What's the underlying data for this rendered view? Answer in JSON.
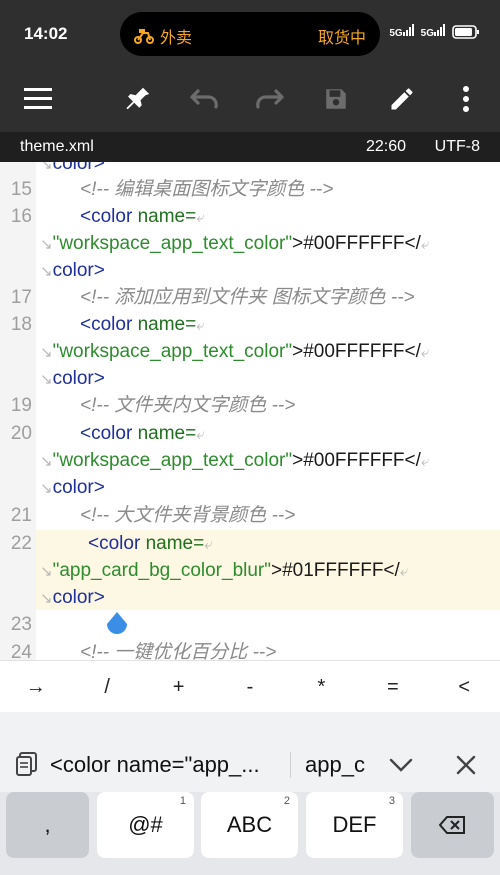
{
  "status_bar": {
    "time": "14:02",
    "island_app": "外卖",
    "island_status": "取货中",
    "signal1": "5G",
    "signal2": "5G"
  },
  "toolbar": {
    "icons": [
      "menu-icon",
      "pin-icon",
      "undo-icon",
      "redo-icon",
      "save-icon",
      "edit-icon",
      "more-icon"
    ]
  },
  "file_info": {
    "filename": "theme.xml",
    "position": "22:60",
    "encoding": "UTF-8"
  },
  "editor": {
    "top_partial": "color>",
    "lines": [
      {
        "num": "15",
        "comment": "<!-- 编辑桌面图标文字颜色 -->"
      },
      {
        "num": "16",
        "open": "<color",
        "attr": "name=",
        "value": "\"workspace_app_text_color\"",
        "text": ">#00FFFFFF</",
        "close": "color>"
      },
      {
        "num": "17",
        "comment": "<!-- 添加应用到文件夹 图标文字颜色 -->"
      },
      {
        "num": "18",
        "open": "<color",
        "attr": "name=",
        "value": "\"workspace_app_text_color\"",
        "text": ">#00FFFFFF</",
        "close": "color>"
      },
      {
        "num": "19",
        "comment": "<!-- 文件夹内文字颜色 -->"
      },
      {
        "num": "20",
        "open": "<color",
        "attr": "name=",
        "value": "\"workspace_app_text_color\"",
        "text": ">#00FFFFFF</",
        "close": "color>"
      },
      {
        "num": "21",
        "comment": "<!-- 大文件夹背景颜色 -->"
      },
      {
        "num": "22",
        "open": "<color",
        "attr": "name=",
        "value": "\"app_card_bg_color_blur\"",
        "text": ">#01FFFFFF</",
        "close": "color>"
      },
      {
        "num": "23"
      },
      {
        "num": "24",
        "comment": "<!-- 一键优化百分比 -->"
      }
    ]
  },
  "symbols": [
    "→",
    "/",
    "+",
    "-",
    "*",
    "=",
    "<"
  ],
  "suggestions": {
    "primary": "<color name=\"app_...",
    "secondary": "app_c"
  },
  "keyboard": {
    "keys": [
      {
        "label": ",",
        "sub": ""
      },
      {
        "label": "@#",
        "sub": "1"
      },
      {
        "label": "ABC",
        "sub": "2"
      },
      {
        "label": "DEF",
        "sub": "3"
      }
    ]
  },
  "colors": {
    "toolbar_bg": "#2f2f2f",
    "highlight_line": "#fdf8e4",
    "cursor_blue": "#3a8ee6",
    "island_accent": "#f5a623"
  }
}
